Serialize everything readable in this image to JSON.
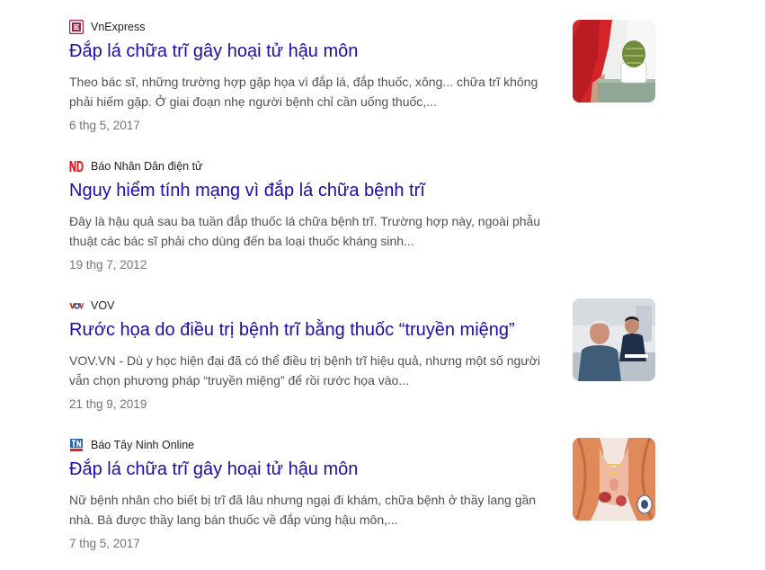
{
  "results": [
    {
      "source": "VnExpress",
      "favicon": "vnexpress-favicon",
      "title": "Đắp lá chữa trĩ gây hoại tử hậu môn",
      "snippet": "Theo bác sĩ, những trường hợp gặp họa vì đắp lá, đắp thuốc, xông... chữa trĩ không phải hiếm gặp. Ở giai đoạn nhẹ người bệnh chỉ cần uống thuốc,...",
      "date": "6 thg 5, 2017",
      "thumbnail": "red-dress-cactus-thumbnail"
    },
    {
      "source": "Báo Nhân Dân điện tử",
      "favicon": "nhandan-favicon",
      "title": "Nguy hiểm tính mạng vì đắp lá chữa bệnh trĩ",
      "snippet": "Đây là hậu quả sau ba tuần đắp thuốc lá chữa bệnh trĩ. Trường hợp này, ngoài phẫu thuật các bác sĩ phải cho dùng đến ba loại thuốc kháng sinh...",
      "date": "19 thg 7, 2012"
    },
    {
      "source": "VOV",
      "favicon": "vov-favicon",
      "title": "Rước họa do điều trị bệnh trĩ bằng thuốc “truyền miệng”",
      "snippet": "VOV.VN - Dù y học hiện đại đã có thể điều trị bệnh trĩ hiệu quả, nhưng một số người vẫn chọn phương pháp “truyền miệng” để rồi rước họa vào...",
      "date": "21 thg 9, 2019",
      "thumbnail": "doctor-patient-thumbnail"
    },
    {
      "source": "Báo Tây Ninh Online",
      "favicon": "tayninh-favicon",
      "title": "Đắp lá chữa trĩ gây hoại tử hậu môn",
      "snippet": "Nữ bệnh nhân cho biết bị trĩ đã lâu nhưng ngại đi khám, chữa bệnh ở thầy lang gần nhà. Bà được thầy lang bán thuốc về đắp vùng hậu môn,...",
      "date": "7 thg 5, 2017",
      "thumbnail": "anatomy-illustration-thumbnail"
    }
  ],
  "colors": {
    "title_link": "#1a0dab",
    "snippet": "#4d5156",
    "date": "#70757a"
  }
}
